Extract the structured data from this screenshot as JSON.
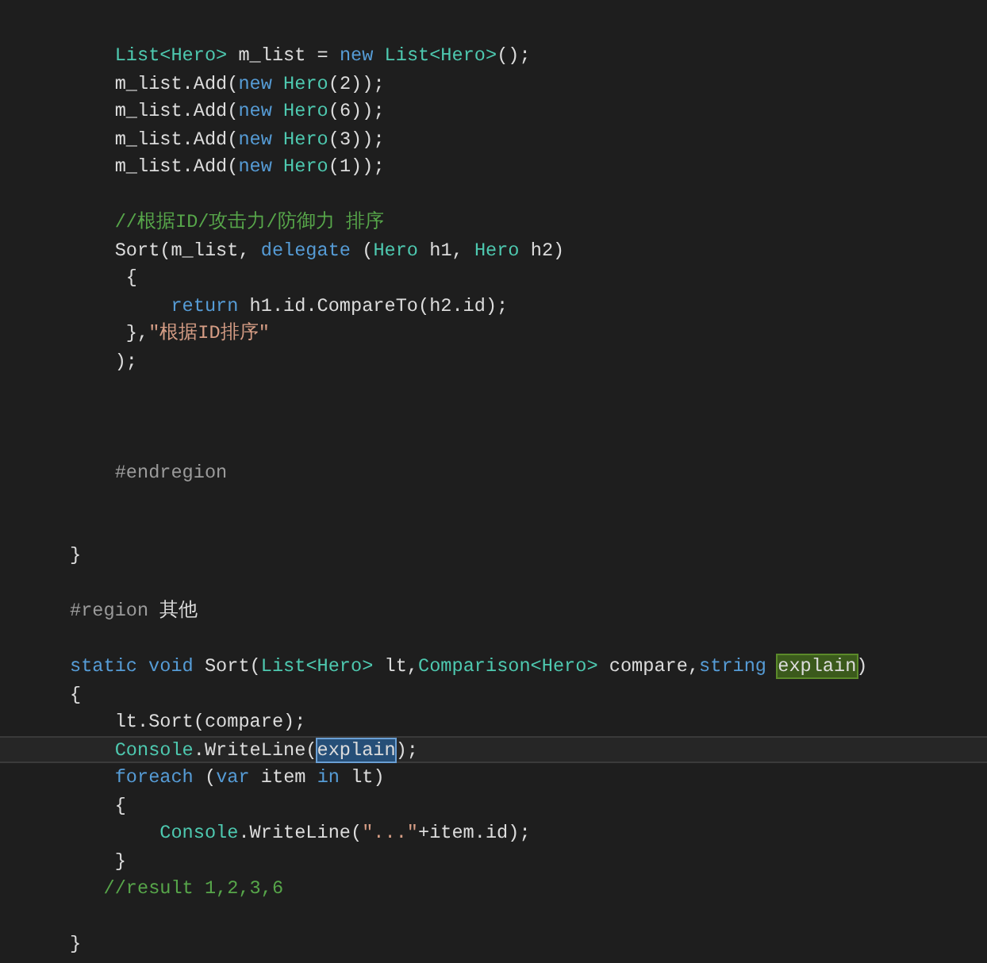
{
  "editor": {
    "lines": [
      {
        "current": false,
        "tokens": [
          {
            "kind": "type",
            "text": "    List<Hero>"
          },
          {
            "kind": "plain",
            "text": " m_list = "
          },
          {
            "kind": "keyword",
            "text": "new"
          },
          {
            "kind": "type",
            "text": " List<Hero>"
          },
          {
            "kind": "plain",
            "text": "();"
          }
        ]
      },
      {
        "current": false,
        "tokens": [
          {
            "kind": "plain",
            "text": "    m_list.Add("
          },
          {
            "kind": "keyword",
            "text": "new"
          },
          {
            "kind": "type",
            "text": " Hero"
          },
          {
            "kind": "plain",
            "text": "(2));"
          }
        ]
      },
      {
        "current": false,
        "tokens": [
          {
            "kind": "plain",
            "text": "    m_list.Add("
          },
          {
            "kind": "keyword",
            "text": "new"
          },
          {
            "kind": "type",
            "text": " Hero"
          },
          {
            "kind": "plain",
            "text": "(6));"
          }
        ]
      },
      {
        "current": false,
        "tokens": [
          {
            "kind": "plain",
            "text": "    m_list.Add("
          },
          {
            "kind": "keyword",
            "text": "new"
          },
          {
            "kind": "type",
            "text": " Hero"
          },
          {
            "kind": "plain",
            "text": "(3));"
          }
        ]
      },
      {
        "current": false,
        "tokens": [
          {
            "kind": "plain",
            "text": "    m_list.Add("
          },
          {
            "kind": "keyword",
            "text": "new"
          },
          {
            "kind": "type",
            "text": " Hero"
          },
          {
            "kind": "plain",
            "text": "(1));"
          }
        ]
      },
      {
        "current": false
      },
      {
        "current": false,
        "tokens": [
          {
            "kind": "comment",
            "text": "    //根据ID/攻击力/防御力 排序"
          }
        ]
      },
      {
        "current": false,
        "tokens": [
          {
            "kind": "plain",
            "text": "    Sort(m_list, "
          },
          {
            "kind": "keyword",
            "text": "delegate"
          },
          {
            "kind": "plain",
            "text": " ("
          },
          {
            "kind": "type",
            "text": "Hero"
          },
          {
            "kind": "plain",
            "text": " h1, "
          },
          {
            "kind": "type",
            "text": "Hero"
          },
          {
            "kind": "plain",
            "text": " h2)"
          }
        ]
      },
      {
        "current": false,
        "tokens": [
          {
            "kind": "plain",
            "text": "     {"
          }
        ]
      },
      {
        "current": false,
        "tokens": [
          {
            "kind": "keyword",
            "text": "         return"
          },
          {
            "kind": "plain",
            "text": " h1.id.CompareTo(h2.id);"
          }
        ]
      },
      {
        "current": false,
        "tokens": [
          {
            "kind": "plain",
            "text": "     },"
          },
          {
            "kind": "string",
            "text": "\"根据ID排序\""
          }
        ]
      },
      {
        "current": false,
        "tokens": [
          {
            "kind": "plain",
            "text": "    );"
          }
        ]
      },
      {
        "current": false
      },
      {
        "current": false
      },
      {
        "current": false
      },
      {
        "current": false,
        "tokens": [
          {
            "kind": "preprocessor",
            "text": "    #endregion"
          }
        ]
      },
      {
        "current": false
      },
      {
        "current": false
      },
      {
        "current": false,
        "tokens": [
          {
            "kind": "plain",
            "text": "}"
          }
        ]
      },
      {
        "current": false
      },
      {
        "current": false,
        "tokens": [
          {
            "kind": "preprocessor",
            "text": "#region"
          },
          {
            "kind": "plain",
            "text": " 其他"
          }
        ]
      },
      {
        "current": false
      },
      {
        "current": false,
        "tokens": [
          {
            "kind": "keyword",
            "text": "static void"
          },
          {
            "kind": "plain",
            "text": " Sort("
          },
          {
            "kind": "type",
            "text": "List<Hero>"
          },
          {
            "kind": "plain",
            "text": " lt,"
          },
          {
            "kind": "type",
            "text": "Comparison<Hero>"
          },
          {
            "kind": "plain",
            "text": " compare,"
          },
          {
            "kind": "keyword",
            "text": "string"
          },
          {
            "kind": "plain",
            "text": " explain",
            "reference_highlight": true
          },
          {
            "kind": "plain",
            "text": ")"
          }
        ]
      },
      {
        "current": false,
        "tokens": [
          {
            "kind": "plain",
            "text": "{"
          }
        ]
      },
      {
        "current": false,
        "tokens": [
          {
            "kind": "plain",
            "text": "    lt.Sort(compare);"
          }
        ]
      },
      {
        "current": true,
        "tokens": [
          {
            "kind": "type",
            "text": "    Console"
          },
          {
            "kind": "plain",
            "text": ".WriteLine("
          },
          {
            "kind": "plain",
            "text": "explain",
            "selected": true
          },
          {
            "kind": "plain",
            "text": ");"
          }
        ]
      },
      {
        "current": false,
        "tokens": [
          {
            "kind": "keyword",
            "text": "    foreach"
          },
          {
            "kind": "plain",
            "text": " ("
          },
          {
            "kind": "keyword",
            "text": "var"
          },
          {
            "kind": "plain",
            "text": " item "
          },
          {
            "kind": "keyword",
            "text": "in"
          },
          {
            "kind": "plain",
            "text": " lt)"
          }
        ]
      },
      {
        "current": false,
        "tokens": [
          {
            "kind": "plain",
            "text": "    {"
          }
        ]
      },
      {
        "current": false,
        "tokens": [
          {
            "kind": "type",
            "text": "        Console"
          },
          {
            "kind": "plain",
            "text": ".WriteLine("
          },
          {
            "kind": "string",
            "text": "\"...\""
          },
          {
            "kind": "plain",
            "text": "+item.id);"
          }
        ]
      },
      {
        "current": false,
        "tokens": [
          {
            "kind": "plain",
            "text": "    }"
          }
        ]
      },
      {
        "current": false,
        "tokens": [
          {
            "kind": "comment",
            "text": "   //result 1,2,3,6"
          }
        ]
      },
      {
        "current": false
      },
      {
        "current": false,
        "tokens": [
          {
            "kind": "plain",
            "text": "}"
          }
        ]
      }
    ]
  }
}
